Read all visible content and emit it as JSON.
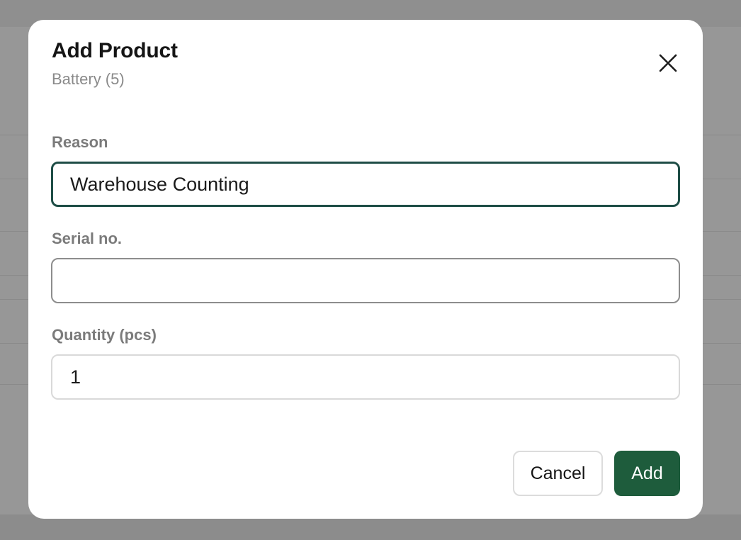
{
  "dialog": {
    "title": "Add Product",
    "subtitle": "Battery (5)",
    "close_icon": "close-icon"
  },
  "fields": {
    "reason": {
      "label": "Reason",
      "value": "Warehouse Counting"
    },
    "serial": {
      "label": "Serial no.",
      "value": ""
    },
    "quantity": {
      "label": "Quantity (pcs)",
      "value": "1"
    }
  },
  "actions": {
    "cancel_label": "Cancel",
    "add_label": "Add"
  },
  "colors": {
    "primary": "#1e5c3c",
    "focus_border": "#1e4d46",
    "backdrop": "#979797"
  }
}
